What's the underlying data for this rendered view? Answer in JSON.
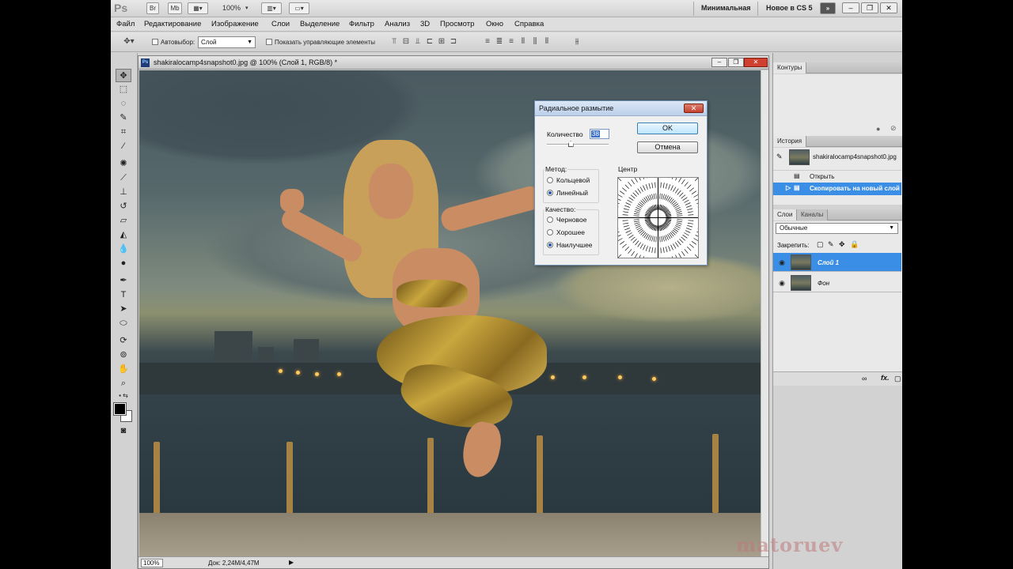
{
  "appbar": {
    "logo": "Ps",
    "br_label": "Br",
    "mb_label": "Mb",
    "zoom": "100%",
    "workspaces": [
      "Минимальная",
      "Новое в CS 5"
    ],
    "more_label": "»"
  },
  "menu": [
    "Файл",
    "Редактирование",
    "Изображение",
    "Слои",
    "Выделение",
    "Фильтр",
    "Анализ",
    "3D",
    "Просмотр",
    "Окно",
    "Справка"
  ],
  "options": {
    "autoselect_label": "Автовыбор:",
    "autoselect_value": "Слой",
    "show_controls_label": "Показать управляющие элементы"
  },
  "document": {
    "title": "shakiralocamp4snapshot0.jpg @ 100% (Слой 1, RGB/8) *",
    "zoom": "100%",
    "doc_size": "Док: 2,24M/4,47M"
  },
  "dialog": {
    "title": "Радиальное размытие",
    "amount_label": "Количество",
    "amount_value": "38",
    "amount_fraction": 0.38,
    "ok_label": "OK",
    "cancel_label": "Отмена",
    "method_label": "Метод:",
    "method_options": [
      "Кольцевой",
      "Линейный"
    ],
    "method_selected": "Линейный",
    "quality_label": "Качество:",
    "quality_options": [
      "Черновое",
      "Хорошее",
      "Наилучшее"
    ],
    "quality_selected": "Наилучшее",
    "center_label": "Центр"
  },
  "panels": {
    "paths_tab": "Контуры",
    "history_tab": "История",
    "history_snapshot": "shakiralocamp4snapshot0.jpg",
    "history_items": [
      "Открыть",
      "Скопировать на новый слой"
    ],
    "layers_tab": "Слои",
    "channels_tab": "Каналы",
    "blend_mode": "Обычные",
    "lock_label": "Закрепить:",
    "layers": [
      "Слой 1",
      "Фон"
    ],
    "fx_label": "fx."
  },
  "watermark": "matoruev",
  "colors": {
    "selection": "#3b8ee6",
    "close_red": "#c4422e"
  }
}
